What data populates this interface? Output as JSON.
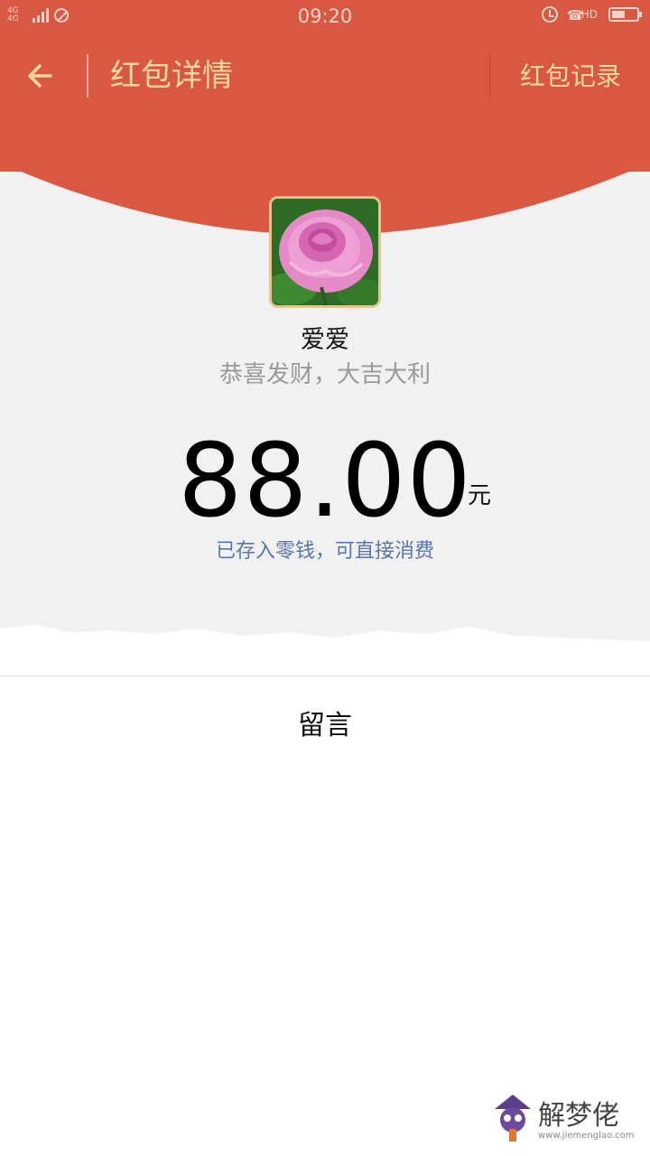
{
  "status_bar": {
    "network": "4G 4G",
    "time": "09:20",
    "hd_label": "HD",
    "battery_level": 0.55
  },
  "nav": {
    "title": "红包详情",
    "records_label": "红包记录"
  },
  "envelope": {
    "sender_name": "爱爱",
    "greeting": "恭喜发财，大吉大利",
    "amount": "88.00",
    "currency_unit": "元",
    "stored_note": "已存入零钱，可直接消费"
  },
  "comments": {
    "title": "留言"
  },
  "watermark": {
    "text": "解梦佬",
    "url": "www.jiemenglao.com"
  },
  "colors": {
    "header_red": "#d95841",
    "header_text_gold": "#f7d8a3",
    "note_blue": "#5a76a8"
  }
}
